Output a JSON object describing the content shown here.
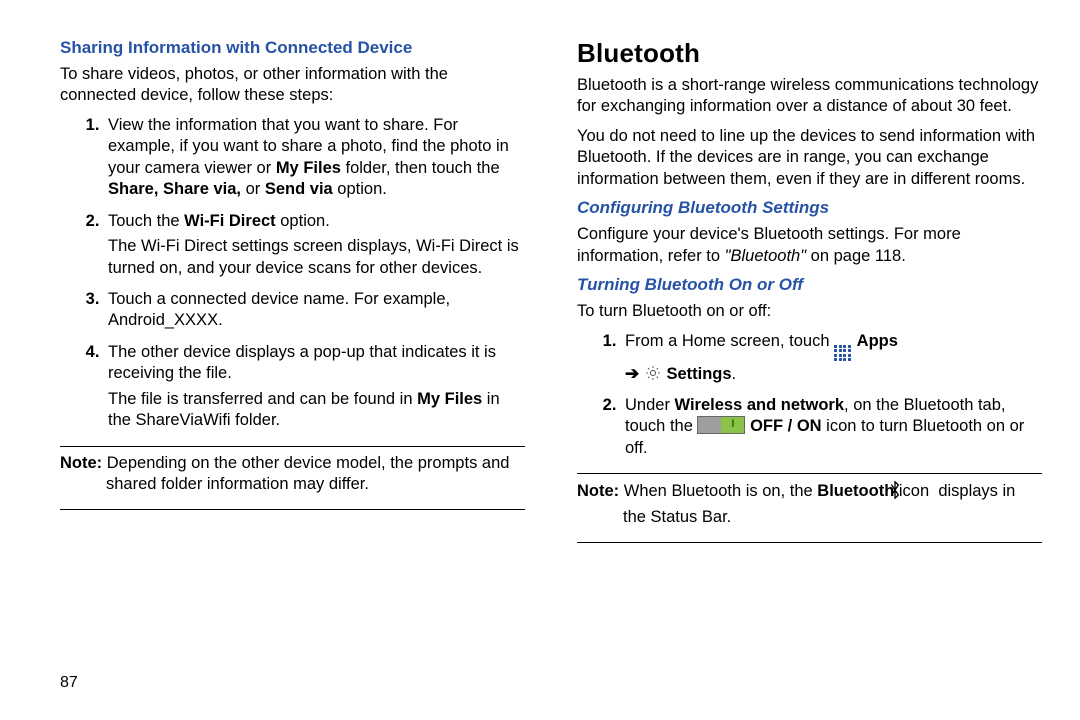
{
  "page_number": "87",
  "left": {
    "h3": "Sharing Information with Connected Device",
    "intro": "To share videos, photos, or other information with the connected device, follow these steps:",
    "steps": {
      "s1_a": "View the information that you want to share. For example, if you want to share a photo, find the photo in your camera viewer or ",
      "s1_b_bold": "My Files",
      "s1_c": " folder, then touch the ",
      "s1_d_bold": "Share, Share via,",
      "s1_e": " or ",
      "s1_f_bold": "Send via",
      "s1_g": " option.",
      "s2_a": "Touch the ",
      "s2_b_bold": "Wi-Fi Direct",
      "s2_c": " option.",
      "s2_p": "The Wi-Fi Direct settings screen displays, Wi-Fi Direct is turned on, and your device scans for other devices.",
      "s3": "Touch a connected device name. For example, Android_XXXX.",
      "s4": "The other device displays a pop-up that indicates it is receiving the file.",
      "s4_p_a": "The file is transferred and can be found in ",
      "s4_p_b_bold": "My Files",
      "s4_p_c": " in the ShareViaWifi folder."
    },
    "note": {
      "label": "Note:",
      "text": " Depending on the other device model, the prompts and shared folder information may differ."
    }
  },
  "right": {
    "h2": "Bluetooth",
    "p1": "Bluetooth is a short-range wireless communications technology for exchanging information over a distance of about 30 feet.",
    "p2": "You do not need to line up the devices to send information with Bluetooth. If the devices are in range, you can exchange information between them, even if they are in different rooms.",
    "h3a": "Configuring Bluetooth Settings",
    "conf_a": "Configure your device's Bluetooth settings. For more information, refer to ",
    "conf_b_italic": "\"Bluetooth\"",
    "conf_c": " on page 118.",
    "h3b": "Turning Bluetooth On or Off",
    "turn_intro": "To turn Bluetooth on or off:",
    "steps": {
      "s1_a": "From a Home screen, touch ",
      "s1_apps_bold": " Apps",
      "s1_arrow": "➔",
      "s1_settings_bold": " Settings",
      "s1_dot": ".",
      "s2_a": "Under ",
      "s2_b_bold": "Wireless and network",
      "s2_c": ", on the Bluetooth tab, touch the ",
      "s2_d_bold": " OFF / ON",
      "s2_e": " icon to turn Bluetooth on or off."
    },
    "note": {
      "label": "Note:",
      "a": " When Bluetooth is on, the ",
      "b_bold": "Bluetooth",
      "c": " icon ",
      "d": " displays in the Status Bar."
    }
  }
}
